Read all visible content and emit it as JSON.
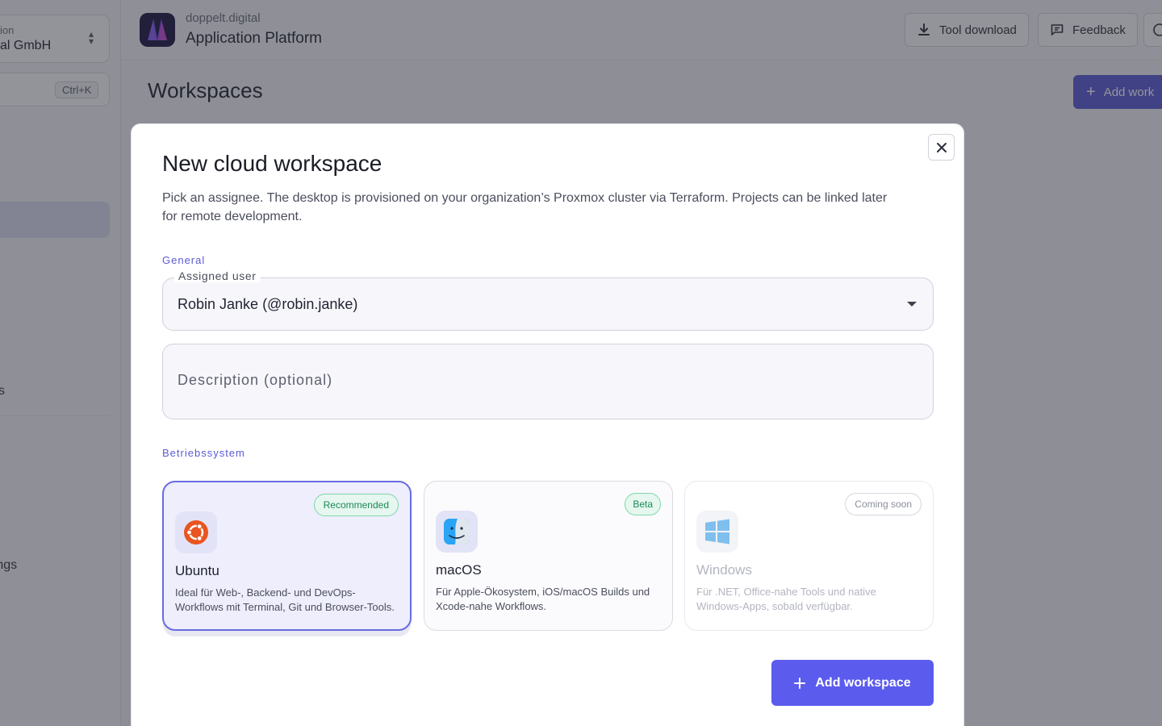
{
  "sidebar": {
    "org_caption": "ion",
    "org_name": "al GmbH",
    "search_shortcut": "Ctrl+K",
    "nav_partial_label": "s",
    "settings_label": "ettings"
  },
  "header": {
    "brand_domain": "doppelt.digital",
    "brand_title": "Application Platform",
    "tool_download": "Tool download",
    "feedback": "Feedback"
  },
  "page": {
    "title": "Workspaces",
    "add_button": "Add work"
  },
  "modal": {
    "title": "New cloud workspace",
    "description": "Pick an assignee. The desktop is provisioned on your organization’s Proxmox cluster via Terraform. Projects can be linked later for remote development.",
    "general_label": "General",
    "assigned_user_label": "Assigned user",
    "assigned_user_value": "Robin Janke (@robin.janke)",
    "description_placeholder": "Description (optional)",
    "os_section_label": "Betriebssystem",
    "os_options": [
      {
        "name": "Ubuntu",
        "badge": "Recommended",
        "text": "Ideal für Web-, Backend- und DevOps-Workflows mit Terminal, Git und Browser-Tools.",
        "icon": "ubuntu-icon",
        "state": "selected"
      },
      {
        "name": "macOS",
        "badge": "Beta",
        "text": "Für Apple-Ökosystem, iOS/macOS Builds und Xcode-nahe Workflows.",
        "icon": "finder-icon",
        "state": "available"
      },
      {
        "name": "Windows",
        "badge": "Coming soon",
        "text": "Für .NET, Office-nahe Tools und native Windows-Apps, sobald verfügbar.",
        "icon": "windows-icon",
        "state": "disabled"
      }
    ],
    "submit_label": "Add workspace"
  },
  "colors": {
    "accent": "#5b5bee",
    "badge_green": "#1a8a56",
    "ubuntu_orange": "#e95420"
  }
}
